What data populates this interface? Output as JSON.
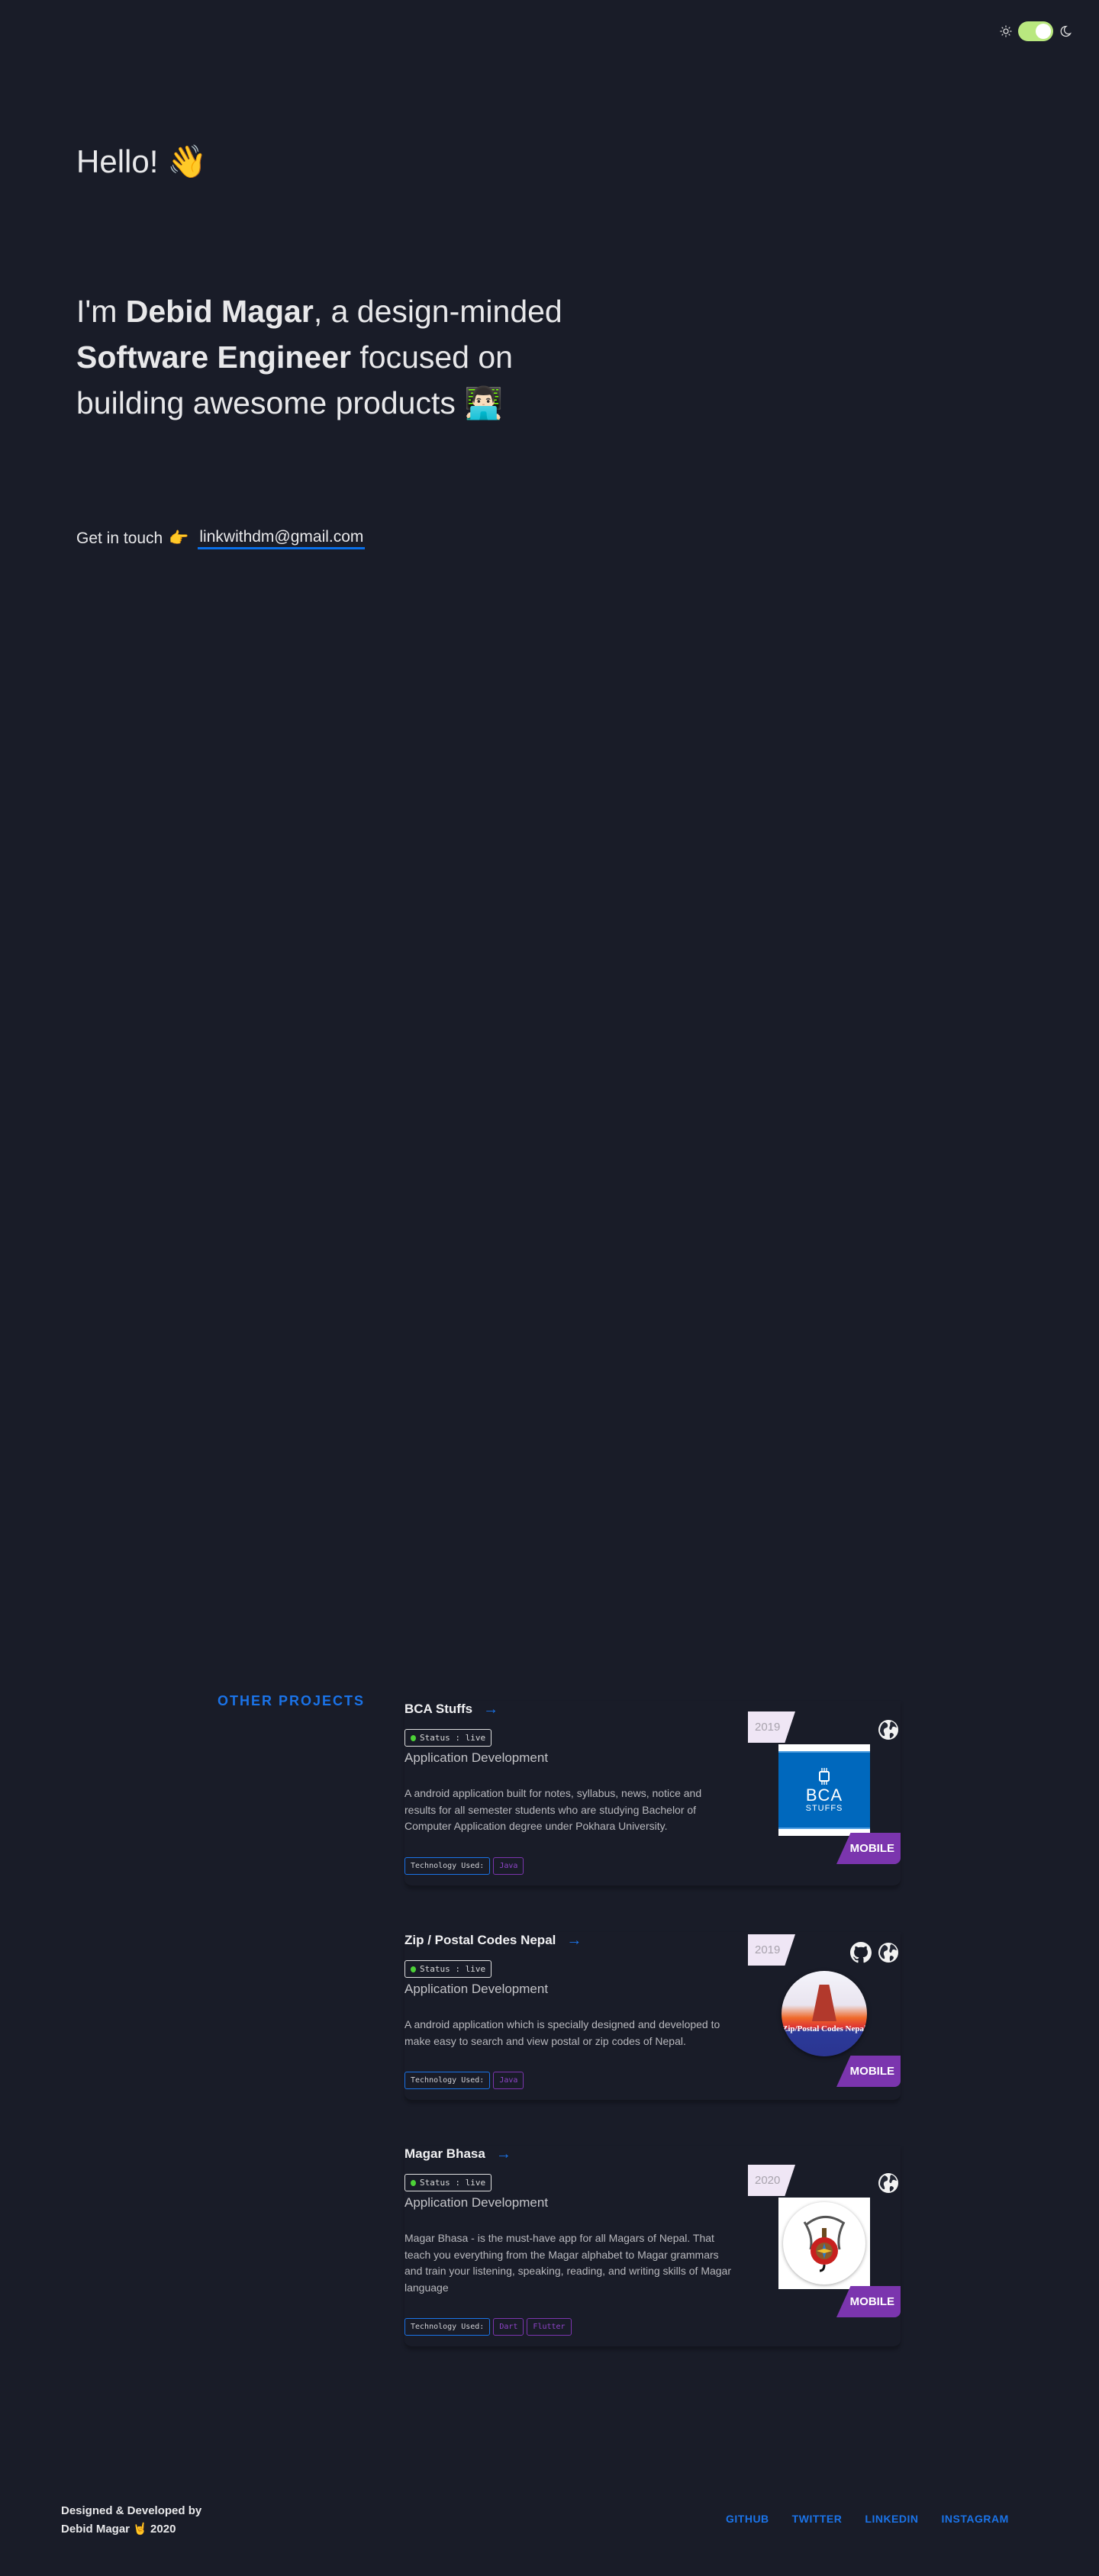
{
  "theme_toggle": {
    "light_icon": "sun-icon",
    "dark_icon": "moon-icon",
    "state": "dark"
  },
  "hero": {
    "greeting": "Hello!",
    "greeting_emoji": "👋",
    "intro_prefix": "I'm ",
    "name": "Debid Magar",
    "intro_mid": ", a design-minded ",
    "role": "Software Engineer",
    "intro_suffix": " focused on building awesome products",
    "intro_emoji": "👨🏻‍💻",
    "contact_label": "Get in touch",
    "contact_emoji": "👉",
    "email": "linkwithdm@gmail.com"
  },
  "other_projects": {
    "heading": "OTHER PROJECTS",
    "projects": [
      {
        "title": "BCA Stuffs",
        "status": "Status : live",
        "category": "Application Development",
        "description": "A android application built for notes, syllabus, news, notice and results for all semester students who are studying Bachelor of Computer Application degree under Pokhara University.",
        "tech_label": "Technology Used:",
        "tech": [
          "Java"
        ],
        "year": "2019",
        "platform": "MOBILE",
        "logo_text": [
          "BCA",
          "STUFFS"
        ]
      },
      {
        "title": "Zip / Postal Codes Nepal",
        "status": "Status : live",
        "category": "Application Development",
        "description": "A android application which is specially designed and developed to make easy to search and view postal or zip codes of Nepal.",
        "tech_label": "Technology Used:",
        "tech": [
          "Java"
        ],
        "year": "2019",
        "platform": "MOBILE",
        "logo_text": "Zip/Postal Codes Nepal"
      },
      {
        "title": "Magar Bhasa",
        "status": "Status : live",
        "category": "Application Development",
        "description": "Magar Bhasa - is the must-have app for all Magars of Nepal. That teach you everything from the Magar alphabet to Magar grammars and train your listening, speaking, reading, and writing skills of Magar language",
        "tech_label": "Technology Used:",
        "tech": [
          "Dart",
          "Flutter"
        ],
        "year": "2020",
        "platform": "MOBILE"
      }
    ]
  },
  "footer": {
    "credit_line1": "Designed & Developed by",
    "credit_name": "Debid Magar",
    "credit_emoji": "🤘",
    "credit_year": "2020",
    "links": [
      "GITHUB",
      "TWITTER",
      "LINKEDIN",
      "INSTAGRAM"
    ]
  },
  "colors": {
    "background": "#191c28",
    "accent": "#1a73e8",
    "purple": "#7b35ae",
    "toggle": "#b9e87f",
    "status_dot": "#4cd137"
  }
}
